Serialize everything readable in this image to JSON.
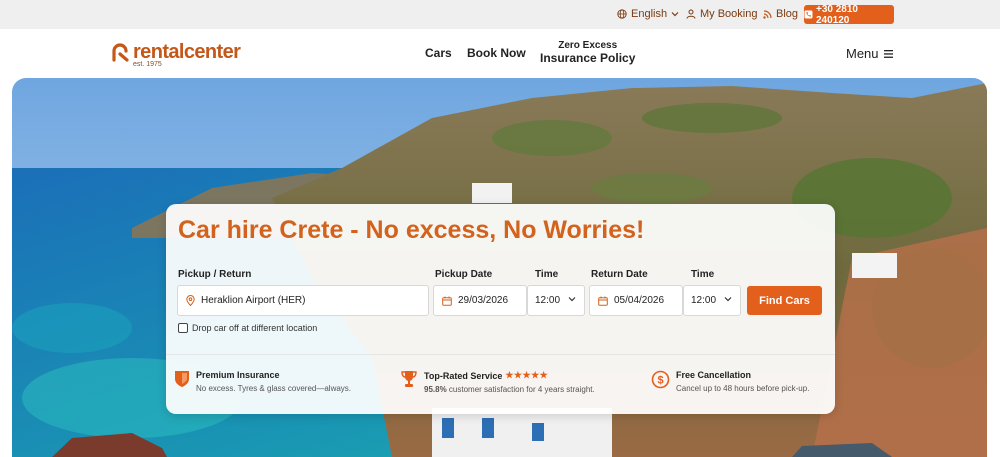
{
  "topbar": {
    "language": "English",
    "my_booking": "My Booking",
    "blog": "Blog",
    "phone": "+30 2810 240120"
  },
  "header": {
    "logo_name": "rentalcenter",
    "logo_sub": "est. 1975",
    "nav": {
      "cars": "Cars",
      "book_now": "Book Now",
      "excess_line1": "Zero Excess",
      "excess_line2": "Insurance Policy",
      "menu": "Menu"
    }
  },
  "booking": {
    "title": "Car hire Crete - No excess, No Worries!",
    "pickup_return_label": "Pickup / Return",
    "location_value": "Heraklion Airport (HER)",
    "pickup_date_label": "Pickup Date",
    "pickup_date": "29/03/2026",
    "time_label": "Time",
    "pickup_time": "12:00",
    "return_date_label": "Return Date",
    "return_date": "05/04/2026",
    "return_time_label": "Time",
    "return_time": "12:00",
    "find_button": "Find Cars",
    "dropoff_label": "Drop car off at different location"
  },
  "features": [
    {
      "title": "Premium Insurance",
      "desc": "No excess. Tyres & glass covered—always.",
      "icon": "shield-icon"
    },
    {
      "title": "Top-Rated Service",
      "stars": "★★★★★",
      "desc_bold": "95.8%",
      "desc": " customer satisfaction for 4 years straight.",
      "icon": "trophy-icon"
    },
    {
      "title": "Free Cancellation",
      "desc": "Cancel up to 48 hours before pick-up.",
      "icon": "refund-icon"
    }
  ],
  "colors": {
    "accent": "#e2601b",
    "title": "#d3621c",
    "brand": "#c4581a"
  }
}
